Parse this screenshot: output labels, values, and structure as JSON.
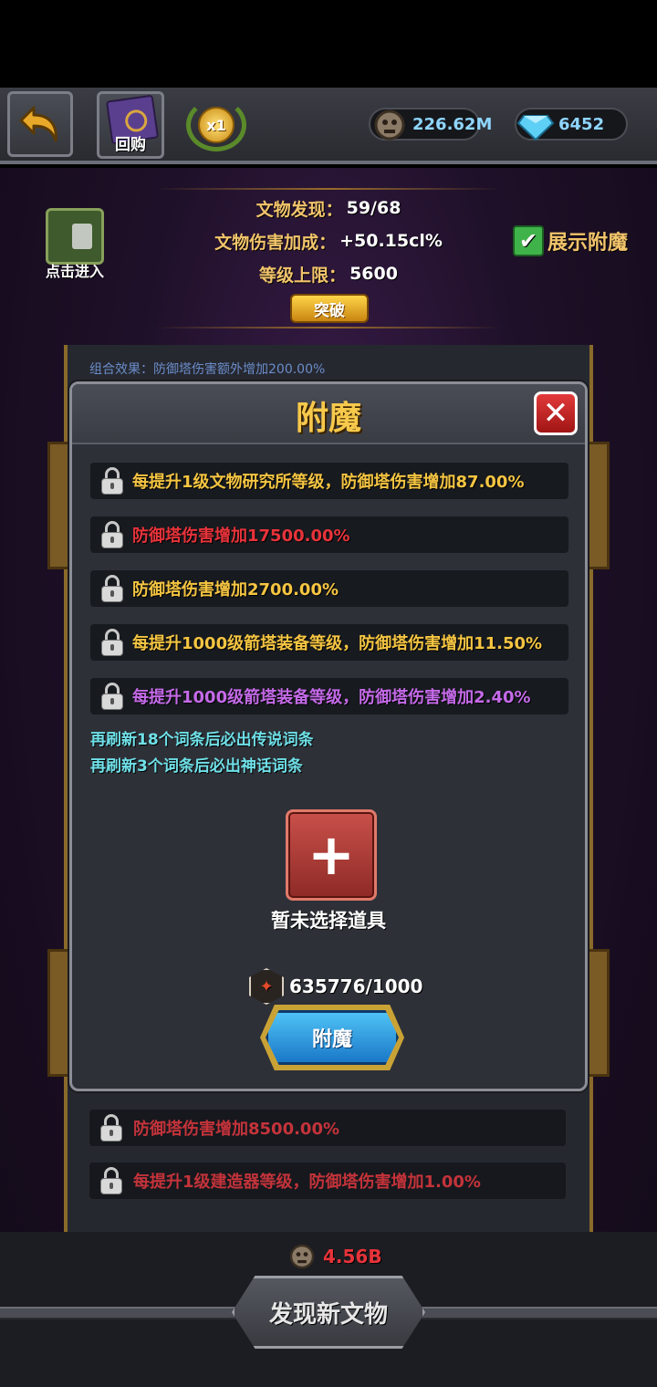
{
  "header": {
    "buyback_label": "回购",
    "speed": "x1",
    "relic_currency": "226.62M",
    "gem_currency": "6452"
  },
  "stats": {
    "discovered_label": "文物发现：",
    "discovered_value": "59/68",
    "damage_label": "文物伤害加成：",
    "damage_value": "+50.15cl%",
    "level_cap_label": "等级上限：",
    "level_cap_value": "5600",
    "breakthrough_label": "突破"
  },
  "enter_label": "点击进入",
  "show_enchant_label": "展示附魔",
  "combo_effect": "组合效果：防御塔伤害额外增加200.00%",
  "modal": {
    "title": "附魔",
    "rows": [
      {
        "text": "每提升1级文物研究所等级，防御塔伤害增加87.00%",
        "color": "#f5c542"
      },
      {
        "text": "防御塔伤害增加17500.00%",
        "color": "#e8333a"
      },
      {
        "text": "防御塔伤害增加2700.00%",
        "color": "#f5c542"
      },
      {
        "text": "每提升1000级箭塔装备等级，防御塔伤害增加11.50%",
        "color": "#f5c542"
      },
      {
        "text": "每提升1000级箭塔装备等级，防御塔伤害增加2.40%",
        "color": "#c46ae8"
      }
    ],
    "refresh_legendary": "再刷新18个词条后必出传说词条",
    "refresh_mythic": "再刷新3个词条后必出神话词条",
    "no_item": "暂未选择道具",
    "cost": "635776/1000",
    "enchant_button": "附魔"
  },
  "background_rows": [
    {
      "text": "防御塔伤害增加8500.00%",
      "color": "#c4333a"
    },
    {
      "text": "每提升1级建造器等级，防御塔伤害增加1.00%",
      "color": "#c4333a"
    }
  ],
  "footer": {
    "discover_cost": "4.56B",
    "discover_button": "发现新文物"
  }
}
